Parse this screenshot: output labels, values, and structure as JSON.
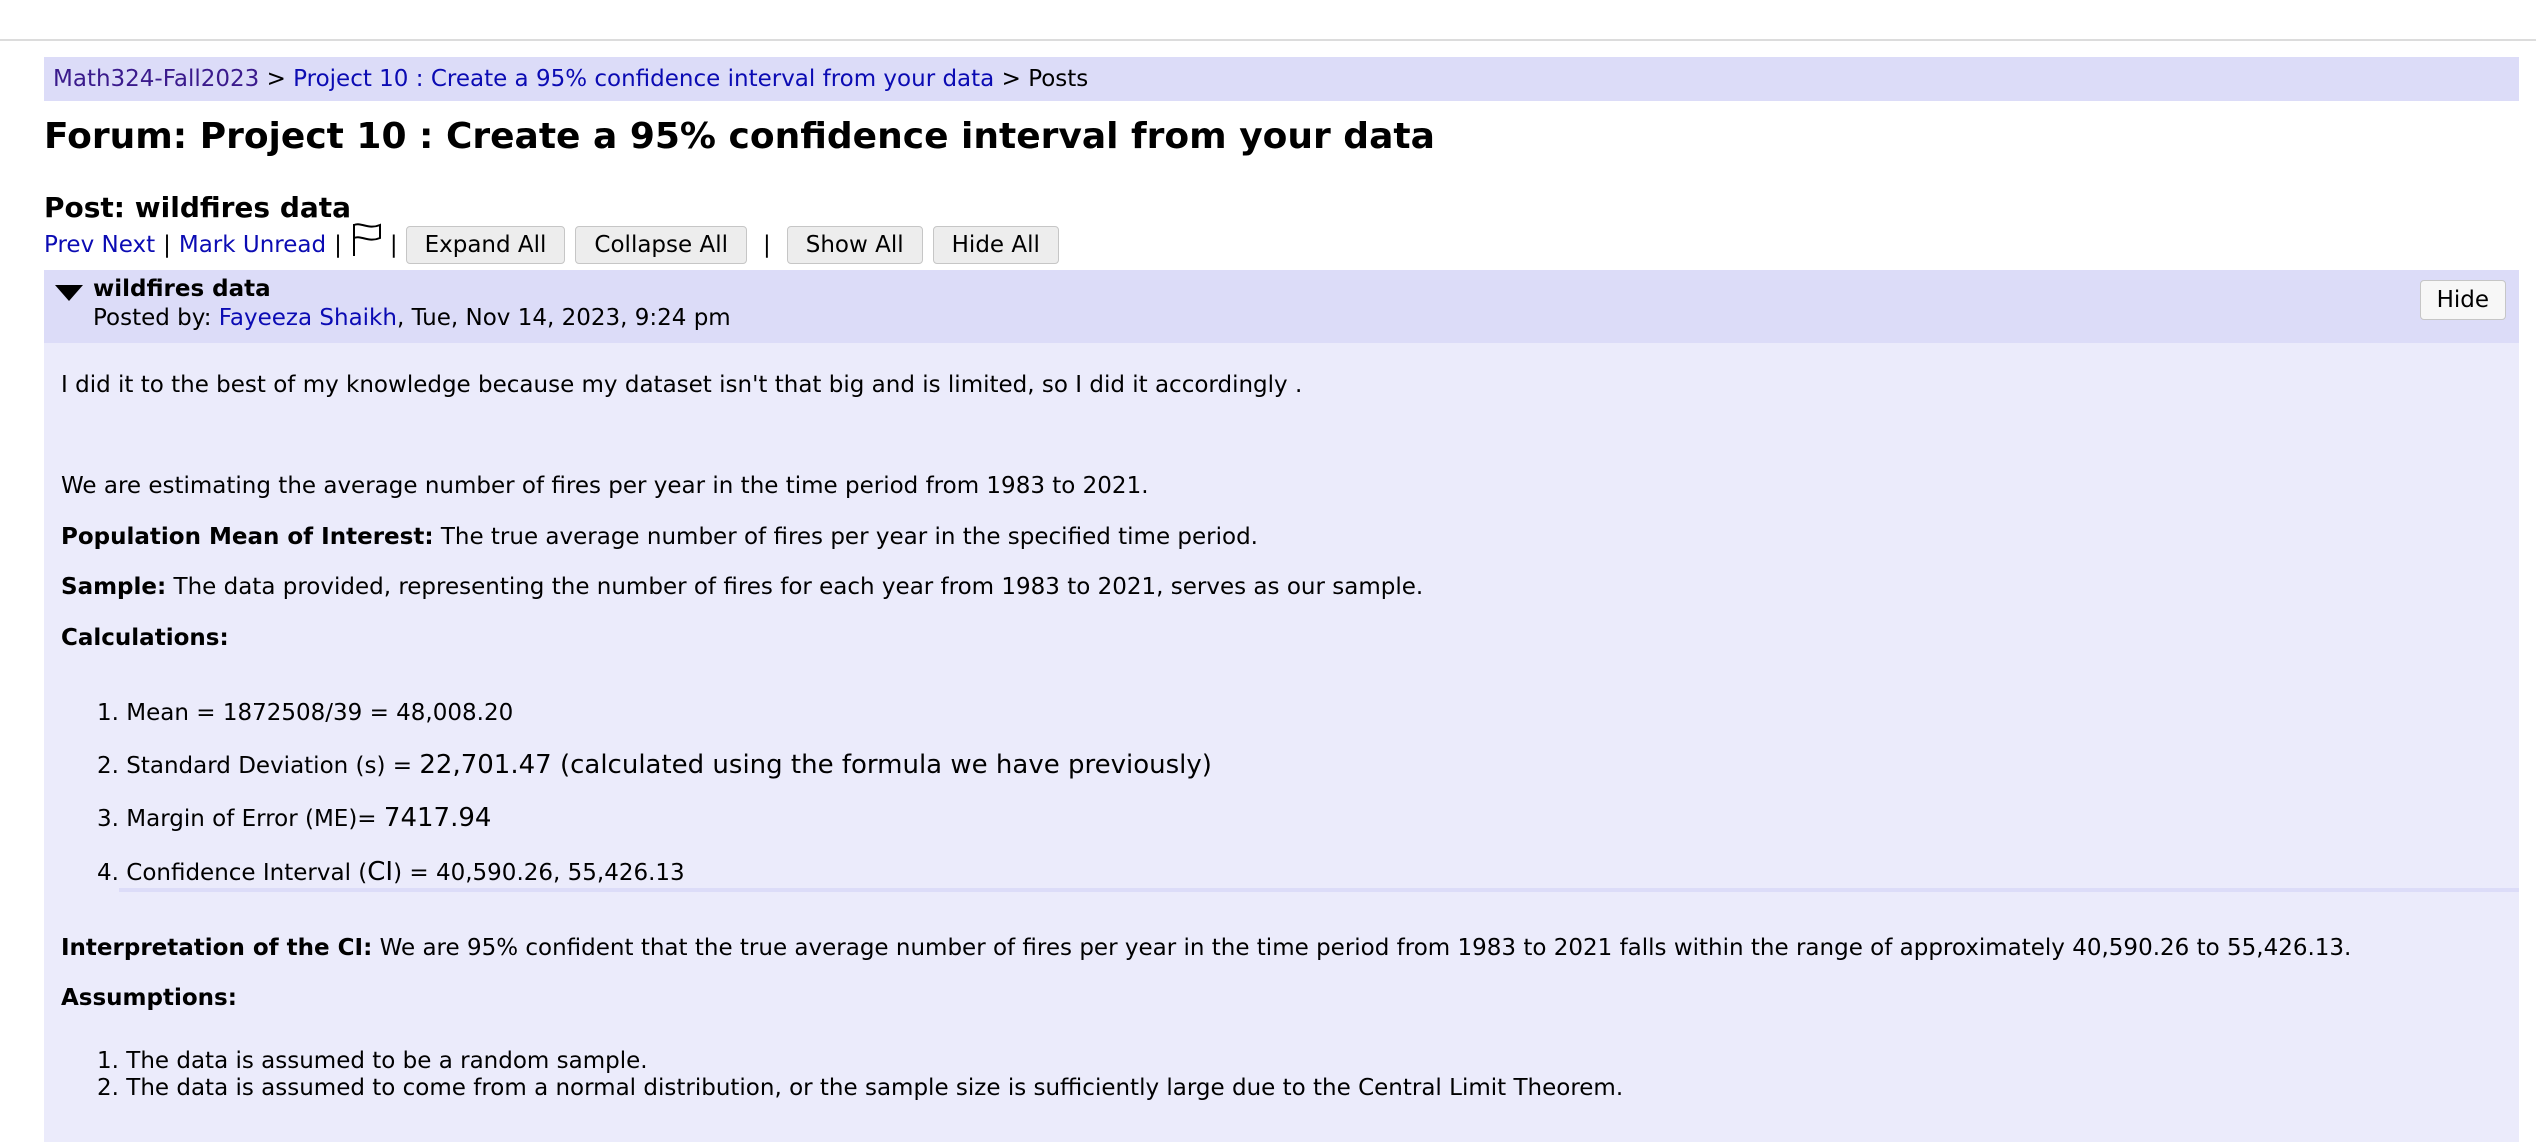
{
  "breadcrumb": {
    "course": "Math324-Fall2023",
    "sep1": ">",
    "forum": "Project 10 : Create a 95% confidence interval from your data",
    "sep2": ">",
    "current": "Posts"
  },
  "forum_title": "Forum: Project 10 : Create a 95% confidence interval from your data",
  "post_title": "Post: wildfires data",
  "toolbar": {
    "prev": "Prev",
    "next": "Next",
    "pipe": "|",
    "mark_unread": "Mark Unread",
    "flag_icon": "flag-outline-icon",
    "expand_all": "Expand All",
    "collapse_all": "Collapse All",
    "show_all": "Show All",
    "hide_all": "Hide All"
  },
  "post": {
    "subject": "wildfires data",
    "posted_by_label": "Posted by:",
    "author": "Fayeeza Shaikh",
    "date": ", Tue, Nov 14, 2023, 9:24 pm",
    "hide": "Hide",
    "collapse_icon": "triangle-down-icon",
    "intro": "I did it to the best of my knowledge because my dataset isn't that big and is limited, so I did it accordingly .",
    "estimating": "We are estimating the average number of fires per year in the time period from 1983 to 2021.",
    "pop_mean_label": "Population Mean of Interest:",
    "pop_mean_text": " The true average number of fires per year in the specified time period.",
    "sample_label": "Sample:",
    "sample_text": " The data provided, representing the number of fires for each year from 1983 to 2021, serves as our sample.",
    "calculations_label": "Calculations:",
    "calc": [
      {
        "num": "1.",
        "a": "Mean = 1872508/39 = 48,008.20",
        "b": "",
        "c": ""
      },
      {
        "num": "2.",
        "a": "Standard Deviation (s) = ",
        "b": "22,701.47 (calculated using the formula we have previously)",
        "c": ""
      },
      {
        "num": "3.",
        "a": "Margin of Error (ME)= ",
        "b": "7417.94",
        "c": ""
      },
      {
        "num": "4.",
        "a": "Confidence Interval (",
        "b": "CI",
        "c": ") = 40,590.26, 55,426.13"
      }
    ],
    "interp_label": "Interpretation of the CI:",
    "interp_text": " We are 95% confident that the true average number of fires per year in the time period from 1983 to 2021 falls within the range of approximately 40,590.26 to 55,426.13.",
    "assumptions_label": "Assumptions:",
    "assumptions": [
      {
        "num": "1.",
        "text": "The data is assumed to be a random sample."
      },
      {
        "num": "2.",
        "text": "The data is assumed to come from a normal distribution, or the sample size is sufficiently large due to the Central Limit Theorem."
      }
    ]
  }
}
